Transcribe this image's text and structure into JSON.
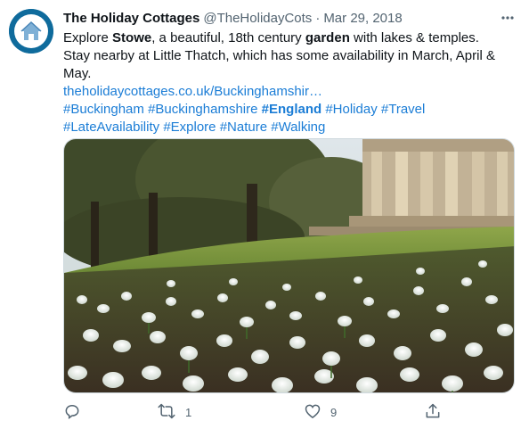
{
  "tweet": {
    "author": {
      "display_name": "The Holiday Cottages",
      "handle": "@TheHolidayCots"
    },
    "separator": "·",
    "date": "Mar 29, 2018",
    "more_icon": "ellipsis-icon",
    "text": {
      "p1": "Explore ",
      "b1": "Stowe",
      "p2": ", a beautiful, 18th century ",
      "b2": "garden",
      "p3": " with lakes & temples.",
      "line2": "Stay nearby at Little Thatch, which has some availability in March, April & May."
    },
    "link": "theholidaycottages.co.uk/Buckinghamshir…",
    "hashtags": {
      "buckingham": "#Buckingham",
      "buckinghamshire": "#Buckinghamshire",
      "england": "#England",
      "holiday": "#Holiday",
      "travel": "#Travel",
      "late_availability": "#LateAvailability",
      "explore": "#Explore",
      "nature": "#Nature",
      "walking": "#Walking"
    },
    "media": {
      "description_icon": "photo-icon",
      "subject": "snowdrops in front of a stone temple"
    },
    "actions": {
      "reply": {
        "icon": "reply-icon",
        "count": ""
      },
      "retweet": {
        "icon": "retweet-icon",
        "count": "1"
      },
      "like": {
        "icon": "heart-icon",
        "count": "9"
      },
      "share": {
        "icon": "share-icon",
        "count": ""
      }
    },
    "colors": {
      "link": "#1b7dd6",
      "muted": "#536471",
      "text": "#0f1419",
      "avatar_bg": "#0f6b9c"
    }
  }
}
